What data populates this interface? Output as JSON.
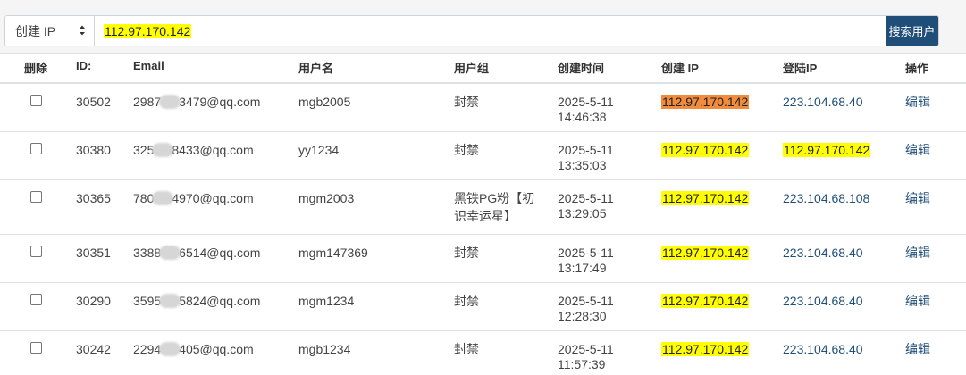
{
  "search": {
    "field_select": "创建 IP",
    "value": "112.97.170.142",
    "button_label": "搜索用户"
  },
  "columns": {
    "delete": "删除",
    "id": "ID:",
    "email": "Email",
    "username": "用户名",
    "group": "用户组",
    "created_time": "创建时间",
    "created_ip": "创建 IP",
    "login_ip": "登陆IP",
    "action": "操作"
  },
  "rows": [
    {
      "id": "30502",
      "email_pre": "2987",
      "email_post": "3479@qq.com",
      "username": "mgb2005",
      "group": "封禁",
      "date": "2025-5-11",
      "time": "14:46:38",
      "created_ip": "112.97.170.142",
      "login_ip": "223.104.68.40",
      "action": "编辑"
    },
    {
      "id": "30380",
      "email_pre": "325",
      "email_post": "8433@qq.com",
      "username": "yy1234",
      "group": "封禁",
      "date": "2025-5-11",
      "time": "13:35:03",
      "created_ip": "112.97.170.142",
      "login_ip": "112.97.170.142",
      "action": "编辑"
    },
    {
      "id": "30365",
      "email_pre": "780",
      "email_post": "4970@qq.com",
      "username": "mgm2003",
      "group": "黑铁PG粉【初识幸运星】",
      "date": "2025-5-11",
      "time": "13:29:05",
      "created_ip": "112.97.170.142",
      "login_ip": "223.104.68.108",
      "action": "编辑"
    },
    {
      "id": "30351",
      "email_pre": "3388",
      "email_post": "6514@qq.com",
      "username": "mgm147369",
      "group": "封禁",
      "date": "2025-5-11",
      "time": "13:17:49",
      "created_ip": "112.97.170.142",
      "login_ip": "223.104.68.40",
      "action": "编辑"
    },
    {
      "id": "30290",
      "email_pre": "3595",
      "email_post": "5824@qq.com",
      "username": "mgm1234",
      "group": "封禁",
      "date": "2025-5-11",
      "time": "12:28:30",
      "created_ip": "112.97.170.142",
      "login_ip": "223.104.68.40",
      "action": "编辑"
    },
    {
      "id": "30242",
      "email_pre": "2294",
      "email_post": "405@qq.com",
      "username": "mgb1234",
      "group": "封禁",
      "date": "2025-5-11",
      "time": "11:57:39",
      "created_ip": "112.97.170.142",
      "login_ip": "223.104.68.40",
      "action": "编辑"
    }
  ],
  "colors": {
    "highlight": "#ffff00",
    "highlight_active": "#f08c3c",
    "button": "#1f4e79",
    "link": "#1f4e79"
  }
}
